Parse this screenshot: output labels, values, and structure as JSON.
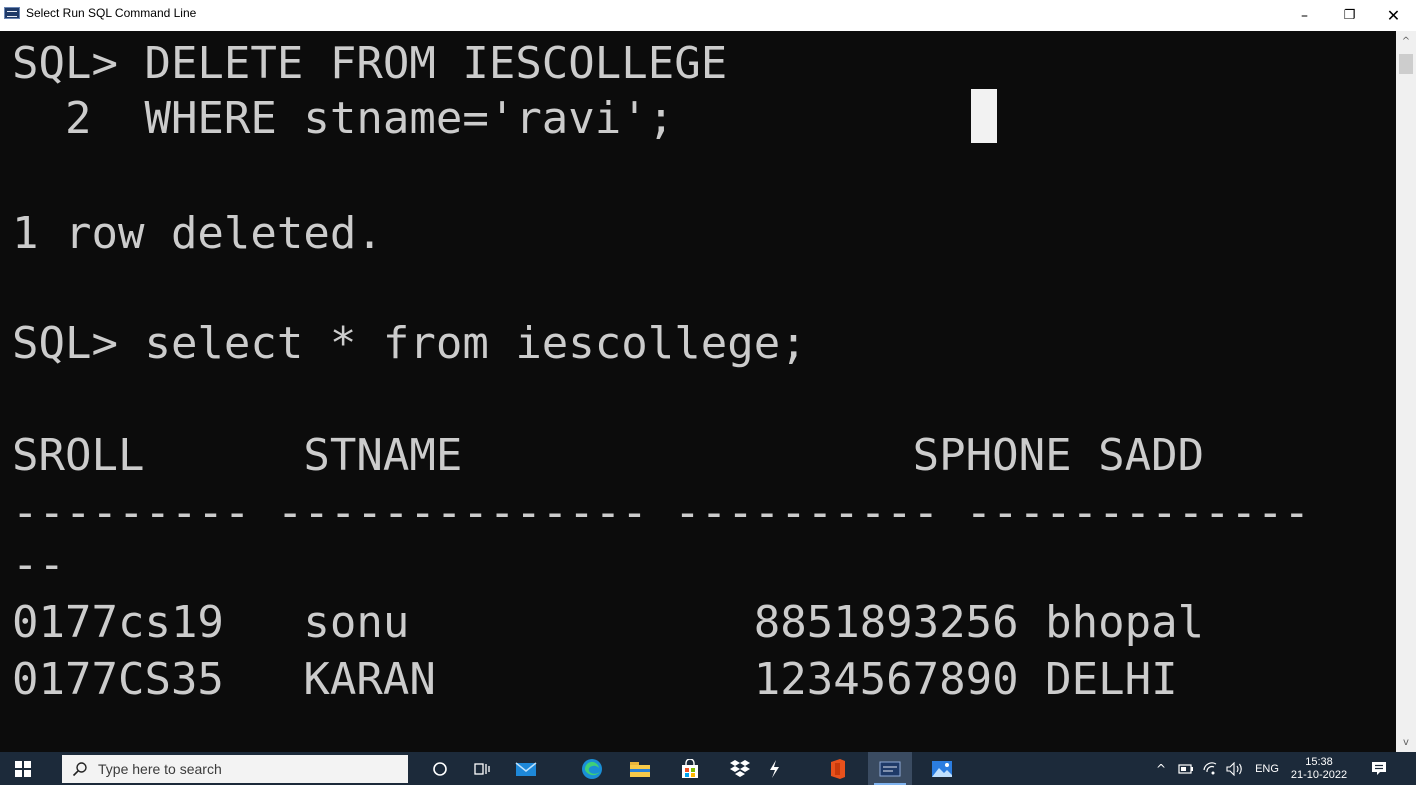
{
  "window": {
    "title": "Select Run SQL Command Line",
    "minimize_glyph": "–",
    "maximize_glyph": "❐",
    "close_glyph": "✕"
  },
  "console": {
    "lines": [
      "SQL> DELETE FROM IESCOLLEGE",
      "  2  WHERE stname='ravi';",
      "",
      "1 row deleted.",
      "",
      "SQL> select * from iescollege;",
      "",
      "SROLL      STNAME                 SPHONE SADD",
      "--------- -------------- ---------- -------------",
      "--",
      "0177cs19   sonu             8851893256 bhopal",
      "0177CS35   KARAN            1234567890 DELHI"
    ]
  },
  "scrollbar": {
    "up_glyph": "^",
    "down_glyph": "v"
  },
  "taskbar": {
    "search_placeholder": "Type here to search",
    "pinned_icons": [
      "cortana-icon",
      "task-view-icon",
      "mail-icon",
      "edge-icon",
      "file-explorer-icon",
      "store-icon",
      "dropbox-icon",
      "app-icon",
      "office-icon",
      "sql-command-line-icon",
      "photos-icon"
    ],
    "tray": {
      "chevron_glyph": "^",
      "language": "ENG",
      "time": "15:38",
      "date": "21-10-2022"
    }
  },
  "colors": {
    "console_bg": "#0c0c0c",
    "console_text": "#cccccc",
    "taskbar_bg": "#1c2a3a",
    "accent": "#7fb3ef"
  }
}
